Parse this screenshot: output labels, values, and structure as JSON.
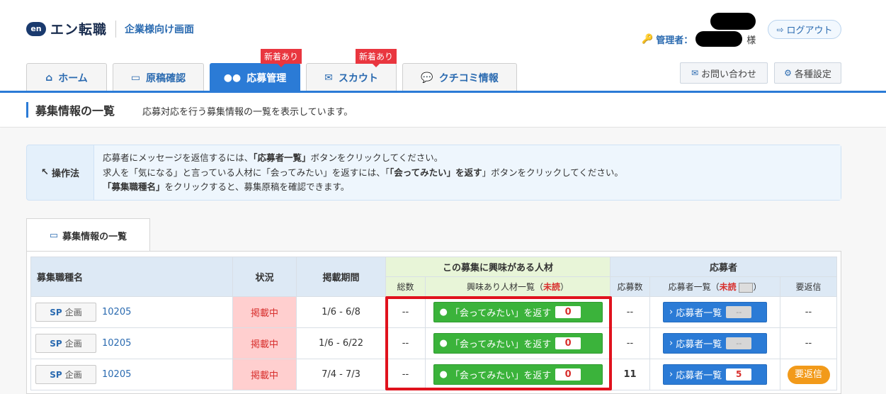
{
  "header": {
    "logo_mark": "en",
    "logo_text": "エン転職",
    "subtitle": "企業様向け画面",
    "admin_label": "管理者：",
    "honorific": "様",
    "logout_label": "ログアウト"
  },
  "tabs": [
    {
      "label": "ホーム",
      "icon": "home-icon"
    },
    {
      "label": "原稿確認",
      "icon": "stack-icon"
    },
    {
      "label": "応募管理",
      "icon": "users-icon",
      "badge": "新着あり",
      "active": true
    },
    {
      "label": "スカウト",
      "icon": "mail-icon",
      "badge": "新着あり"
    },
    {
      "label": "クチコミ情報",
      "icon": "chat-icon"
    }
  ],
  "right_buttons": {
    "contact": "お問い合わせ",
    "settings": "各種設定"
  },
  "page": {
    "title": "募集情報の一覧",
    "description": "応募対応を行う募集情報の一覧を表示しています。"
  },
  "howto": {
    "label": "操作法",
    "line1_a": "応募者にメッセージを返信するには、",
    "line1_b": "「応募者一覧」",
    "line1_c": "ボタンをクリックしてください。",
    "line2_a": "求人を「気になる」と言っている人材に「会ってみたい」を返すには、「",
    "line2_b": "「会ってみたい」を返す",
    "line2_c": "」ボタンをクリックしてください。",
    "line3_a": "「募集職種名」",
    "line3_b": "をクリックすると、募集原稿を確認できます。"
  },
  "section_tab": "募集情報の一覧",
  "table": {
    "headers": {
      "job": "募集職種名",
      "status": "状況",
      "period": "掲載期間",
      "interest_group": "この募集に興味がある人材",
      "total": "総数",
      "interest_list": "興味あり人材一覧（",
      "unread": "未読",
      "close_paren": "）",
      "applicant_group": "応募者",
      "app_count": "応募数",
      "app_list": "応募者一覧（",
      "needs_reply": "要返信"
    },
    "rows": [
      {
        "sp": "SP",
        "kikaku": "企画",
        "job_id": "10205",
        "status": "掲載中",
        "period": "1/6 - 6/8",
        "total": "--",
        "meet_label": "「会ってみたい」を返す",
        "meet_count": "0",
        "app_count": "--",
        "app_label": "応募者一覧",
        "app_unread": "--",
        "reply": "--"
      },
      {
        "sp": "SP",
        "kikaku": "企画",
        "job_id": "10205",
        "status": "掲載中",
        "period": "1/6 - 6/22",
        "total": "--",
        "meet_label": "「会ってみたい」を返す",
        "meet_count": "0",
        "app_count": "--",
        "app_label": "応募者一覧",
        "app_unread": "--",
        "reply": "--"
      },
      {
        "sp": "SP",
        "kikaku": "企画",
        "job_id": "10205",
        "status": "掲載中",
        "period": "7/4 - 7/3",
        "total": "--",
        "meet_label": "「会ってみたい」を返す",
        "meet_count": "0",
        "app_count": "11",
        "app_label": "応募者一覧",
        "app_unread": "5",
        "reply": "要返信"
      }
    ]
  },
  "colors": {
    "brand_blue": "#2b7bd6",
    "green": "#3bb33b",
    "alert_red": "#e0121d",
    "reply_orange": "#f29a1a"
  }
}
